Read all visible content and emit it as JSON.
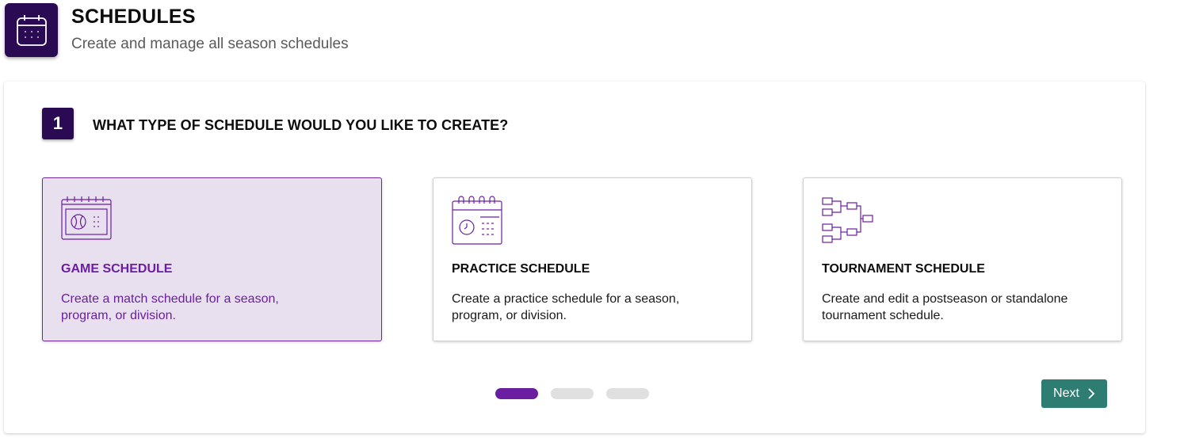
{
  "header": {
    "title": "SCHEDULES",
    "subtitle": "Create and manage all season schedules",
    "icon": "calendar-icon"
  },
  "step": {
    "number": "1",
    "question": "WHAT TYPE OF SCHEDULE WOULD YOU LIKE TO CREATE?"
  },
  "cards": [
    {
      "title": "GAME SCHEDULE",
      "description": "Create a match schedule for a season, program, or division.",
      "icon": "game-calendar-icon",
      "selected": true
    },
    {
      "title": "PRACTICE SCHEDULE",
      "description": "Create a practice schedule for a season, program, or division.",
      "icon": "practice-calendar-icon",
      "selected": false
    },
    {
      "title": "TOURNAMENT SCHEDULE",
      "description": "Create and edit a postseason or standalone tournament schedule.",
      "icon": "tournament-bracket-icon",
      "selected": false
    }
  ],
  "pagination": {
    "total": 3,
    "current": 1
  },
  "footer": {
    "next_label": "Next"
  },
  "colors": {
    "brand": "#2a0a52",
    "accent": "#6a1fa0",
    "selected_bg": "#e8dfef",
    "next_button": "#2e7d73",
    "inactive_dot": "#e0e0e0"
  }
}
